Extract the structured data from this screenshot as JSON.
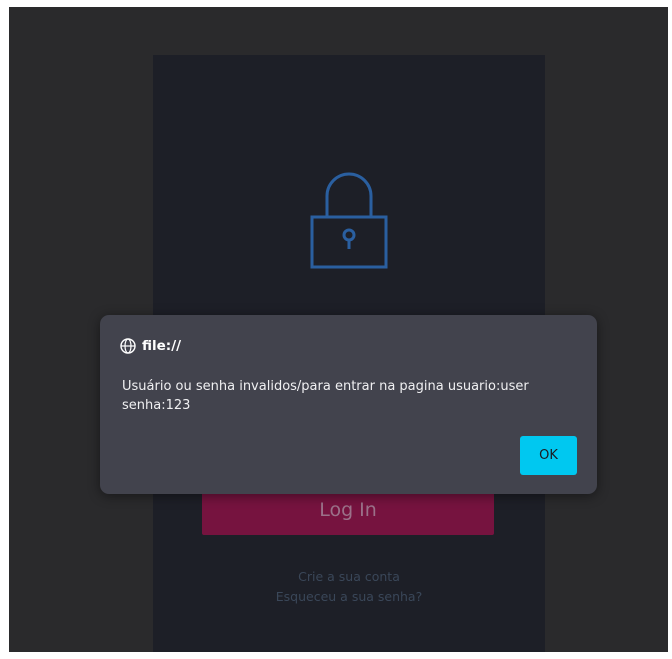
{
  "login": {
    "lock_icon": "padlock-icon",
    "login_button_label": "Log In",
    "create_account_link": "Crie a sua conta",
    "forgot_password_link": "Esqueceu a sua senha?"
  },
  "alert": {
    "origin": "file://",
    "origin_icon": "globe-icon",
    "message": "Usuário ou senha invalidos/para entrar na pagina usuario:user senha:123",
    "ok_label": "OK"
  },
  "colors": {
    "page_background": "#2a2a2c",
    "card_background": "#1d1f27",
    "lock_stroke": "#2a5fa0",
    "login_button": "#76133f",
    "dialog_background": "#42434d",
    "ok_button": "#00c8f0"
  }
}
